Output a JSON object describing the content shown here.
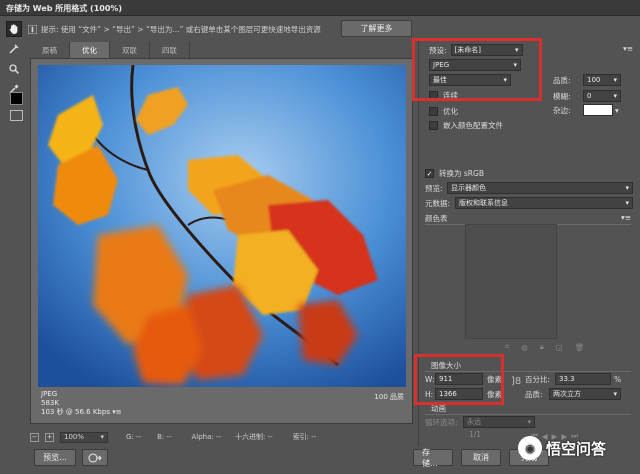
{
  "window": {
    "title": "存储为 Web 所用格式 (100%)"
  },
  "tip": {
    "text": "提示: 使用 “文件” > “导出” > “导出为...” 或右键单击某个图层可更快速地导出资源",
    "learn_more": "了解更多"
  },
  "tabs": [
    "原稿",
    "优化",
    "双联",
    "四联"
  ],
  "active_tab": 1,
  "canvas": {
    "format": "JPEG",
    "size": "583K",
    "speed": "103 秒 @ 56.6 Kbps",
    "quality_readout": "100 品质"
  },
  "statusbar": {
    "zoom": "100%",
    "g": "G: --",
    "b": "B: --",
    "alpha": "Alpha: --",
    "hex": "十六进制: --",
    "index": "索引: --"
  },
  "bottom": {
    "preview": "预览...",
    "save": "存储...",
    "cancel": "取消",
    "done": "完成"
  },
  "panel": {
    "preset_label": "预设:",
    "preset_value": "[未命名]",
    "format": "JPEG",
    "quality_mode": "最佳",
    "quality_label": "品质:",
    "quality_value": "100",
    "progressive": "连续",
    "blur_label": "模糊:",
    "blur_value": "0",
    "optimized": "优化",
    "matte_label": "杂边:",
    "embed_profile": "嵌入颜色配置文件",
    "convert_srgb": "转换为 sRGB",
    "preview_label": "预览:",
    "preview_value": "显示器颜色",
    "metadata_label": "元数据:",
    "metadata_value": "版权和联系信息",
    "color_table": "颜色表",
    "image_size": "图像大小",
    "w_label": "W:",
    "w_value": "911",
    "h_label": "H:",
    "h_value": "1366",
    "unit": "像素",
    "percent_label": "百分比:",
    "percent_value": "33.3",
    "percent_unit": "%",
    "resample_label": "品质:",
    "resample_value": "两次立方",
    "animation": "动画",
    "loop_label": "循环选项:",
    "loop_value": "永远",
    "frame_counter": "1/1"
  },
  "watermark": "悟空问答",
  "colors": {
    "highlight": "#d8312b",
    "bg": "#535353"
  }
}
